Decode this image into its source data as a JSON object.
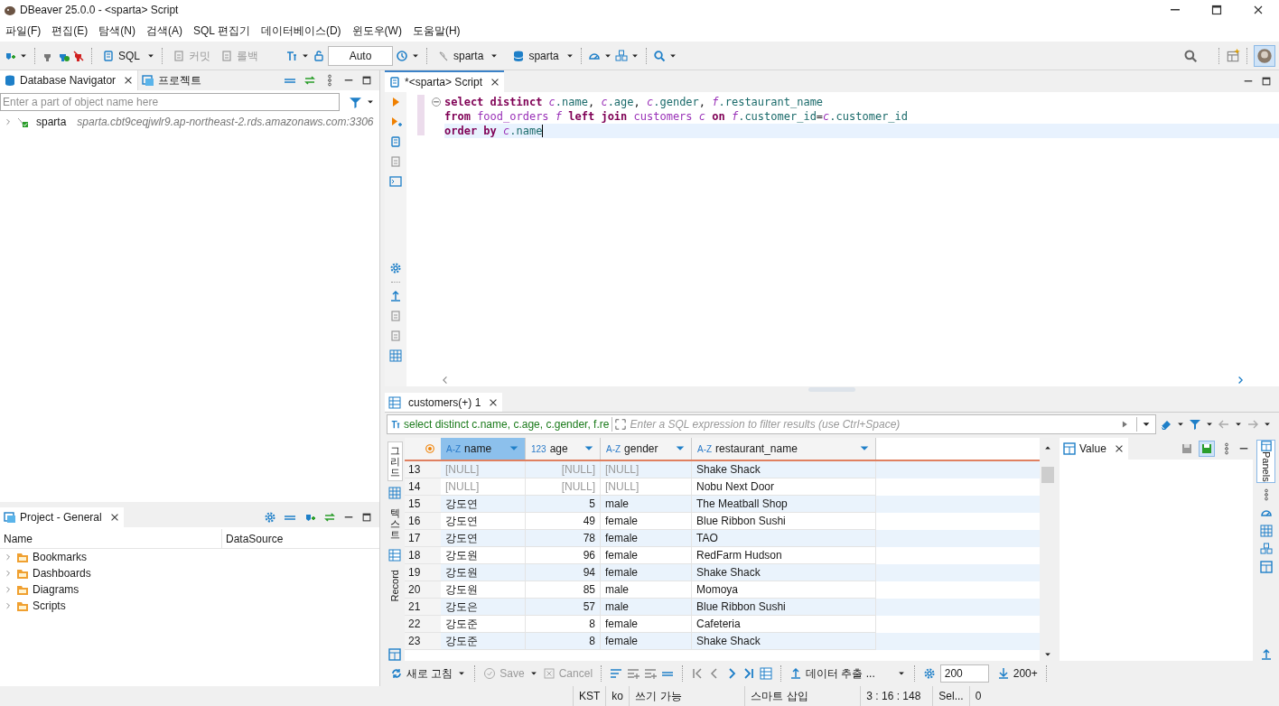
{
  "window": {
    "title": "DBeaver 25.0.0 - <sparta> Script"
  },
  "menu": [
    "파일(F)",
    "편집(E)",
    "탐색(N)",
    "검색(A)",
    "SQL 편집기",
    "데이터베이스(D)",
    "윈도우(W)",
    "도움말(H)"
  ],
  "toolbar": {
    "sql": "SQL",
    "commit": {
      "label": "커밋",
      "disabled": true
    },
    "rollback": {
      "label": "롤백",
      "disabled": true
    },
    "mode": "Auto",
    "datasource": "sparta",
    "schema": "sparta"
  },
  "navigator": {
    "tabs": [
      {
        "label": "Database Navigator",
        "selected": true
      },
      {
        "label": "프로젝트",
        "selected": false
      }
    ],
    "filter_placeholder": "Enter a part of object name here",
    "tree": [
      {
        "name": "sparta",
        "detail": "sparta.cbt9ceqjwlr9.ap-northeast-2.rds.amazonaws.com:3306",
        "expanded": false
      }
    ]
  },
  "project": {
    "title": "Project - General",
    "columns": [
      "Name",
      "DataSource"
    ],
    "items": [
      "Bookmarks",
      "Dashboards",
      "Diagrams",
      "Scripts"
    ]
  },
  "editor": {
    "tab": "*<sparta> Script",
    "lines": [
      {
        "current": false,
        "tokens": [
          {
            "kind": "kw",
            "t": "select distinct "
          },
          {
            "kind": "alias",
            "t": "c"
          },
          {
            "kind": "col",
            "t": ".name"
          },
          {
            "kind": "plain",
            "t": ", "
          },
          {
            "kind": "alias",
            "t": "c"
          },
          {
            "kind": "col",
            "t": ".age"
          },
          {
            "kind": "plain",
            "t": ", "
          },
          {
            "kind": "alias",
            "t": "c"
          },
          {
            "kind": "col",
            "t": ".gender"
          },
          {
            "kind": "plain",
            "t": ", "
          },
          {
            "kind": "alias",
            "t": "f"
          },
          {
            "kind": "col",
            "t": ".restaurant_name"
          }
        ]
      },
      {
        "current": false,
        "tokens": [
          {
            "kind": "kw",
            "t": "from "
          },
          {
            "kind": "table",
            "t": "food_orders "
          },
          {
            "kind": "alias",
            "t": "f "
          },
          {
            "kind": "kw",
            "t": "left join "
          },
          {
            "kind": "table",
            "t": "customers "
          },
          {
            "kind": "alias",
            "t": "c "
          },
          {
            "kind": "kw",
            "t": "on "
          },
          {
            "kind": "alias",
            "t": "f"
          },
          {
            "kind": "col",
            "t": ".customer_id"
          },
          {
            "kind": "plain",
            "t": "="
          },
          {
            "kind": "alias",
            "t": "c"
          },
          {
            "kind": "col",
            "t": ".customer_id"
          }
        ]
      },
      {
        "current": true,
        "tokens": [
          {
            "kind": "kw",
            "t": "order by "
          },
          {
            "kind": "alias",
            "t": "c"
          },
          {
            "kind": "col",
            "t": ".name"
          }
        ]
      }
    ]
  },
  "results": {
    "tab": "customers(+) 1",
    "query": "select distinct c.name, c.age, c.gender, f.re",
    "filter_placeholder": "Enter a SQL expression to filter results (use Ctrl+Space)",
    "view_tabs": [
      {
        "label": "그리드",
        "selected": true
      },
      {
        "label": "텍스트",
        "selected": false
      },
      {
        "label": "Record",
        "selected": false
      }
    ],
    "columns": [
      {
        "type": "A-Z",
        "label": "name",
        "selected": true
      },
      {
        "type": "123",
        "label": "age",
        "selected": false
      },
      {
        "type": "A-Z",
        "label": "gender",
        "selected": false
      },
      {
        "type": "A-Z",
        "label": "restaurant_name",
        "selected": false
      }
    ],
    "rows": [
      {
        "num": "13",
        "cells": [
          {
            "t": "[NULL]",
            "null": true
          },
          {
            "t": "[NULL]",
            "null": true
          },
          {
            "t": "[NULL]",
            "null": true
          },
          {
            "t": "Shake Shack",
            "null": false
          }
        ]
      },
      {
        "num": "14",
        "cells": [
          {
            "t": "[NULL]",
            "null": true
          },
          {
            "t": "[NULL]",
            "null": true
          },
          {
            "t": "[NULL]",
            "null": true
          },
          {
            "t": "Nobu Next Door",
            "null": false
          }
        ]
      },
      {
        "num": "15",
        "cells": [
          {
            "t": "강도연",
            "null": false
          },
          {
            "t": "5",
            "null": false
          },
          {
            "t": "male",
            "null": false
          },
          {
            "t": "The Meatball Shop",
            "null": false
          }
        ]
      },
      {
        "num": "16",
        "cells": [
          {
            "t": "강도연",
            "null": false
          },
          {
            "t": "49",
            "null": false
          },
          {
            "t": "female",
            "null": false
          },
          {
            "t": "Blue Ribbon Sushi",
            "null": false
          }
        ]
      },
      {
        "num": "17",
        "cells": [
          {
            "t": "강도연",
            "null": false
          },
          {
            "t": "78",
            "null": false
          },
          {
            "t": "female",
            "null": false
          },
          {
            "t": "TAO",
            "null": false
          }
        ]
      },
      {
        "num": "18",
        "cells": [
          {
            "t": "강도원",
            "null": false
          },
          {
            "t": "96",
            "null": false
          },
          {
            "t": "female",
            "null": false
          },
          {
            "t": "RedFarm Hudson",
            "null": false
          }
        ]
      },
      {
        "num": "19",
        "cells": [
          {
            "t": "강도원",
            "null": false
          },
          {
            "t": "94",
            "null": false
          },
          {
            "t": "female",
            "null": false
          },
          {
            "t": "Shake Shack",
            "null": false
          }
        ]
      },
      {
        "num": "20",
        "cells": [
          {
            "t": "강도원",
            "null": false
          },
          {
            "t": "85",
            "null": false
          },
          {
            "t": "male",
            "null": false
          },
          {
            "t": "Momoya",
            "null": false
          }
        ]
      },
      {
        "num": "21",
        "cells": [
          {
            "t": "강도은",
            "null": false
          },
          {
            "t": "57",
            "null": false
          },
          {
            "t": "male",
            "null": false
          },
          {
            "t": "Blue Ribbon Sushi",
            "null": false
          }
        ]
      },
      {
        "num": "22",
        "cells": [
          {
            "t": "강도준",
            "null": false
          },
          {
            "t": "8",
            "null": false
          },
          {
            "t": "female",
            "null": false
          },
          {
            "t": "Cafeteria",
            "null": false
          }
        ]
      },
      {
        "num": "23",
        "cells": [
          {
            "t": "강도준",
            "null": false
          },
          {
            "t": "8",
            "null": false
          },
          {
            "t": "female",
            "null": false
          },
          {
            "t": "Shake Shack",
            "null": false
          }
        ]
      }
    ],
    "value_panel": {
      "tab": "Value"
    },
    "side_label": "Panels",
    "bottom": {
      "refresh": "새로 고침",
      "save": {
        "label": "Save",
        "disabled": true
      },
      "cancel": {
        "label": "Cancel",
        "disabled": true
      },
      "export": "데이터 추출 ...",
      "fetch_size": "200",
      "fetch_all": "200+"
    }
  },
  "status_bar": [
    "KST",
    "ko",
    "쓰기 가능",
    "스마트 삽입",
    "3 : 16 : 148",
    "Sel...",
    "0"
  ]
}
